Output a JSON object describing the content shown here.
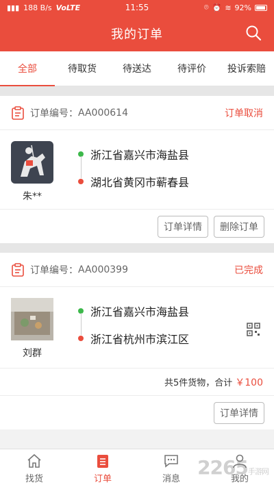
{
  "statusbar": {
    "network": "188 B/s",
    "carrier": "VoLTE",
    "time": "11:55",
    "battery": "92%"
  },
  "header": {
    "title": "我的订单"
  },
  "tabs": [
    {
      "label": "全部",
      "active": true
    },
    {
      "label": "待取货"
    },
    {
      "label": "待送达"
    },
    {
      "label": "待评价"
    },
    {
      "label": "投诉索赔"
    }
  ],
  "orders": [
    {
      "id_label": "订单编号：",
      "id": "AA000614",
      "status": "订单取消",
      "user": "朱**",
      "from": "浙江省嘉兴市海盐县",
      "to": "湖北省黄冈市蕲春县",
      "buttons": [
        "订单详情",
        "删除订单"
      ]
    },
    {
      "id_label": "订单编号：",
      "id": "AA000399",
      "status": "已完成",
      "user": "刘群",
      "from": "浙江省嘉兴市海盐县",
      "to": "浙江省杭州市滨江区",
      "summary": "共5件货物，合计",
      "amount": "￥100",
      "buttons": [
        "订单详情"
      ]
    }
  ],
  "bottomnav": [
    {
      "label": "找货",
      "icon": "home-icon"
    },
    {
      "label": "订单",
      "icon": "order-icon",
      "active": true
    },
    {
      "label": "消息",
      "icon": "message-icon"
    },
    {
      "label": "我的",
      "icon": "profile-icon"
    }
  ],
  "watermark": {
    "text": "2265",
    "sub": "手游网"
  },
  "colors": {
    "accent": "#ea4d3d",
    "green": "#3cb84a"
  }
}
